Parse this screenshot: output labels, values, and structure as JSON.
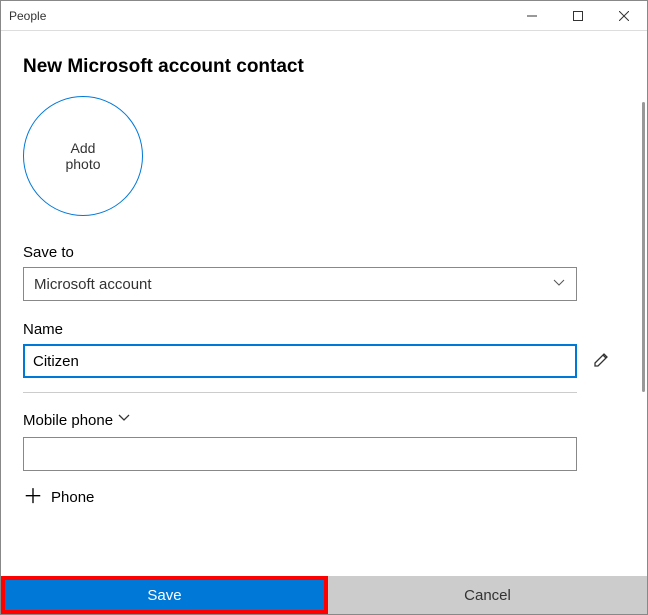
{
  "window": {
    "title": "People"
  },
  "page": {
    "heading": "New Microsoft account contact",
    "add_photo_label": "Add\nphoto"
  },
  "save_to": {
    "label": "Save to",
    "selected": "Microsoft account"
  },
  "name": {
    "label": "Name",
    "value": "Citizen"
  },
  "phone": {
    "type_label": "Mobile phone",
    "value": "",
    "add_label": "Phone"
  },
  "actions": {
    "save": "Save",
    "cancel": "Cancel"
  }
}
